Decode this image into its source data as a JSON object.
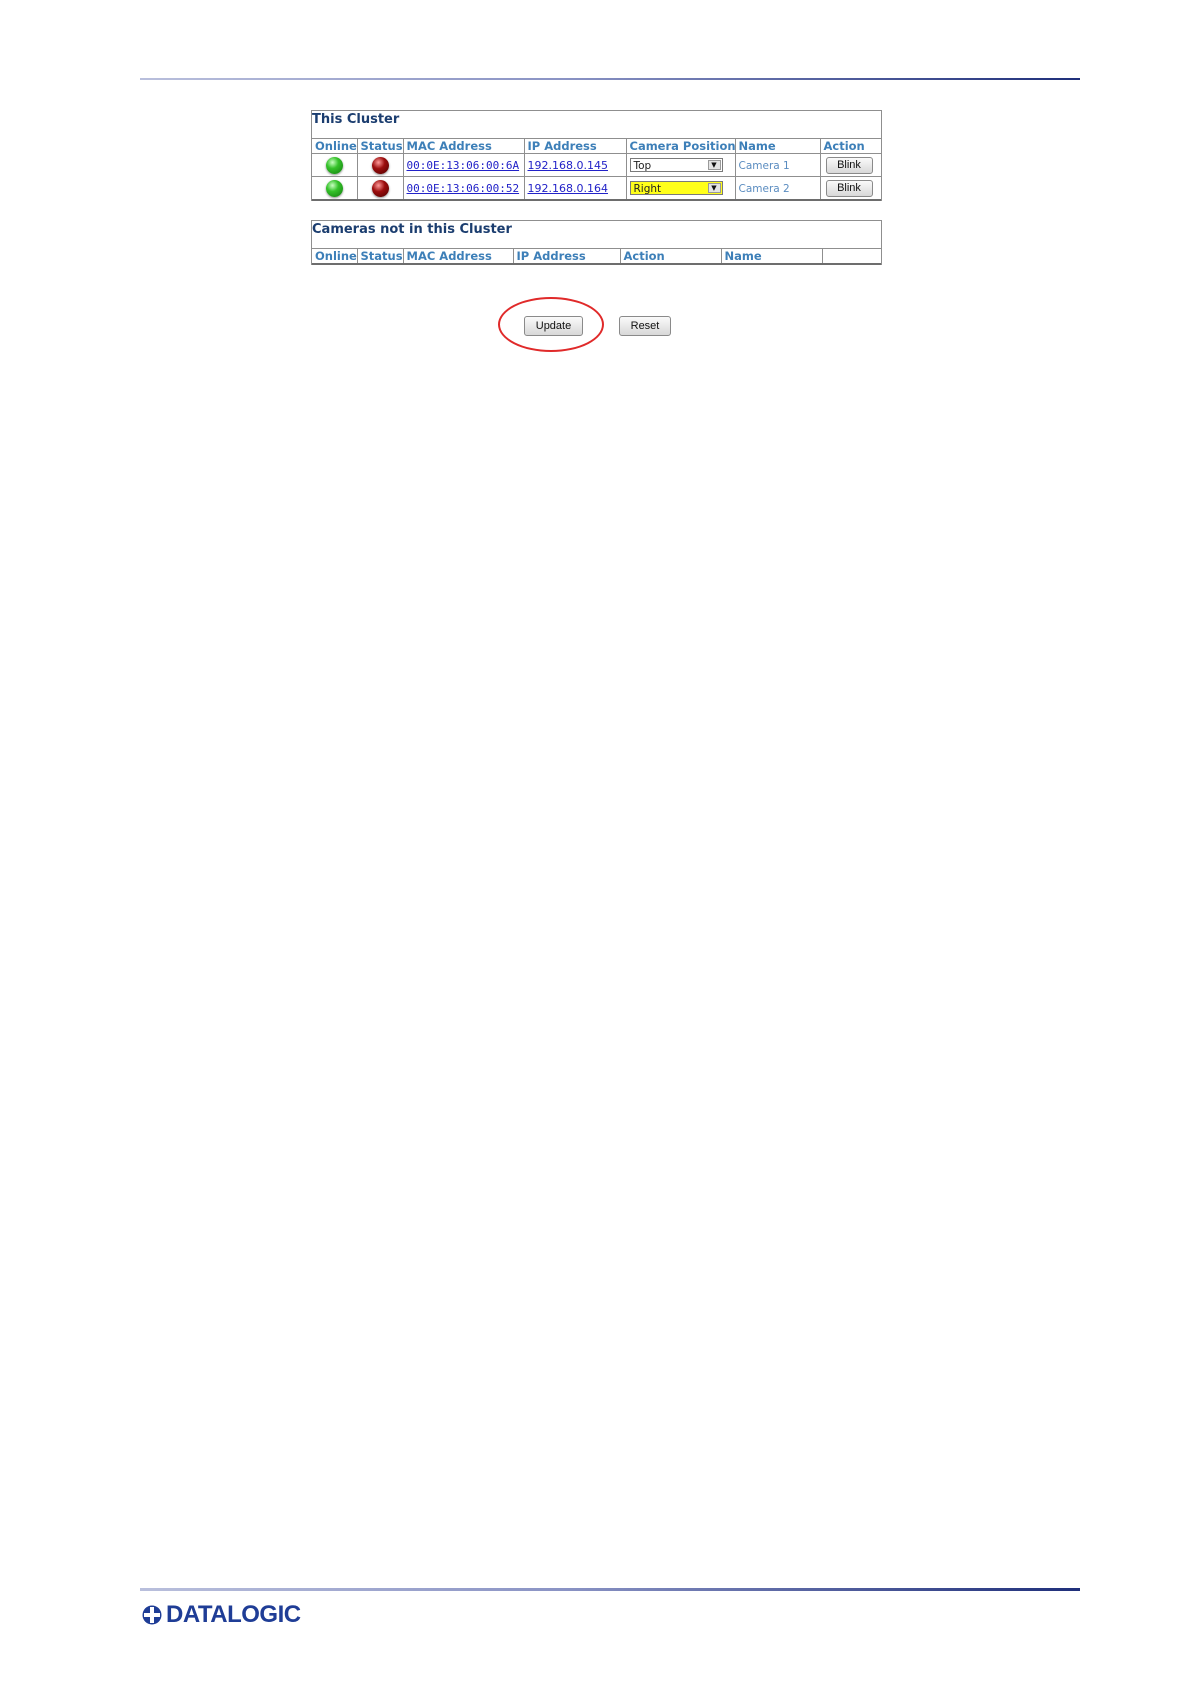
{
  "this_cluster": {
    "title": "This Cluster",
    "columns": [
      "Online",
      "Status",
      "MAC Address",
      "IP Address",
      "Camera Position",
      "Name",
      "Action"
    ],
    "rows": [
      {
        "online": "green",
        "status": "red",
        "mac": "00:0E:13:06:00:6A",
        "ip": "192.168.0.145",
        "position": "Top",
        "position_highlight": false,
        "name": "Camera 1",
        "action": "Blink"
      },
      {
        "online": "green",
        "status": "red",
        "mac": "00:0E:13:06:00:52",
        "ip": "192.168.0.164",
        "position": "Right",
        "position_highlight": true,
        "name": "Camera 2",
        "action": "Blink"
      }
    ]
  },
  "not_in_cluster": {
    "title": "Cameras not in this Cluster",
    "columns": [
      "Online",
      "Status",
      "MAC Address",
      "IP Address",
      "Action",
      "Name",
      ""
    ]
  },
  "buttons": {
    "update": "Update",
    "reset": "Reset"
  },
  "footer": {
    "logo_text": "DATALOGIC"
  },
  "colors": {
    "header_text": "#3d7fb8",
    "title_text": "#1b3d6f",
    "highlight": "#ffff1a",
    "annotation_ring": "#e02a2a",
    "brand": "#1f3d96"
  }
}
